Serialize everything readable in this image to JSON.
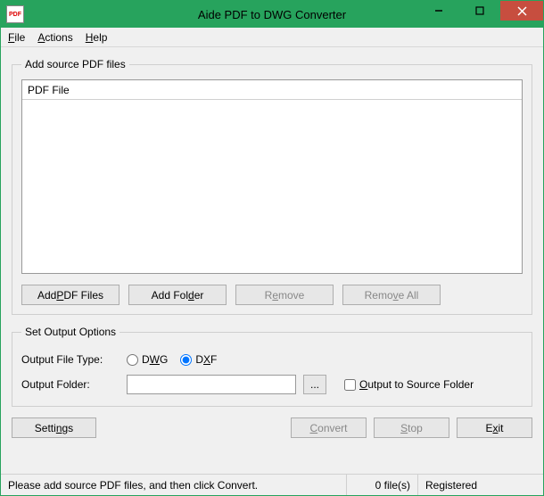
{
  "window": {
    "title": "Aide PDF to DWG Converter",
    "icon_label": "PDF"
  },
  "menu": {
    "file": "File",
    "actions": "Actions",
    "help": "Help"
  },
  "source_group": {
    "legend": "Add source PDF files",
    "column_header": "PDF File",
    "add_pdf": "Add PDF Files",
    "add_folder": "Add Folder",
    "remove": "Remove",
    "remove_all": "Remove All"
  },
  "output_group": {
    "legend": "Set Output Options",
    "file_type_label": "Output File Type:",
    "dwg": "DWG",
    "dxf": "DXF",
    "folder_label": "Output Folder:",
    "folder_value": "",
    "browse": "...",
    "output_to_source": "Output to Source Folder"
  },
  "bottom": {
    "settings": "Settings",
    "convert": "Convert",
    "stop": "Stop",
    "exit": "Exit"
  },
  "status": {
    "message": "Please add source PDF files, and then click Convert.",
    "file_count": "0 file(s)",
    "registration": "Registered"
  }
}
